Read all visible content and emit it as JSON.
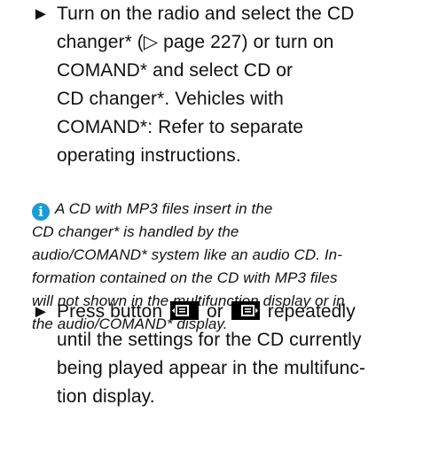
{
  "step1": {
    "bullet": "►",
    "lines": [
      "Turn on the radio and select the CD",
      "changer* (▷ page 227) or turn on",
      "COMAND* and select CD or",
      "CD changer*. Vehicles with",
      "COMAND*: Refer to separate",
      "operating instructions."
    ]
  },
  "note": {
    "icon": "info-icon",
    "lines": [
      "A CD with MP3 files insert in the",
      "CD changer* is handled by the",
      "audio/COMAND* system like an audio CD. In-",
      "formation contained on the CD with MP3 files",
      "will not shown in the multifunction display or in",
      "the audio/COMAND* display."
    ]
  },
  "step2": {
    "bullet": "►",
    "prefix": "Press button",
    "button_prev_icon": "display-prev-button-icon",
    "or": "or",
    "button_next_icon": "display-next-button-icon",
    "suffix_line1": "repeatedly",
    "lines": [
      "until the settings for the CD currently",
      "being played appear in the multifunc-",
      "tion display."
    ]
  }
}
